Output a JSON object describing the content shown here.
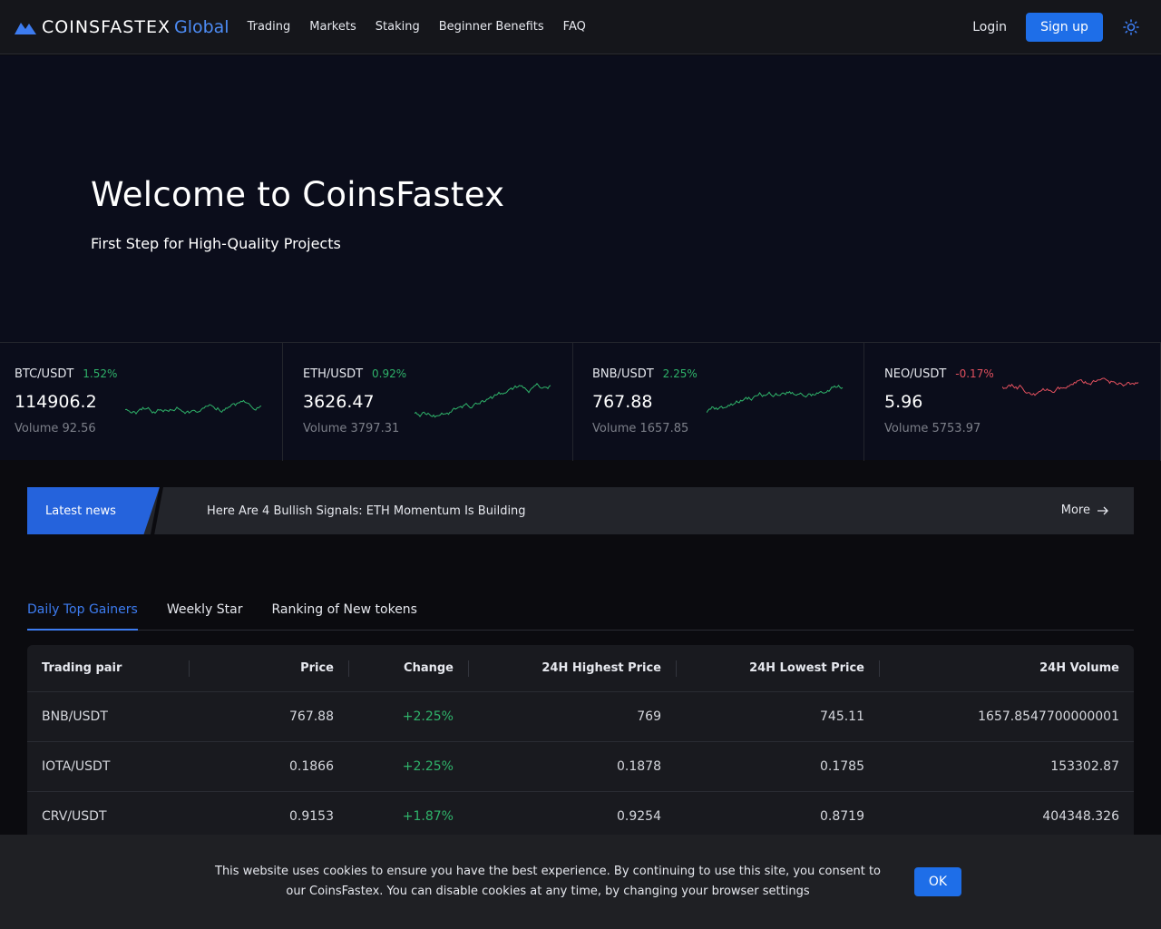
{
  "header": {
    "logo_text": "COINSFASTEX",
    "logo_sub": "Global",
    "nav": [
      "Trading",
      "Markets",
      "Staking",
      "Beginner Benefits",
      "FAQ"
    ],
    "login": "Login",
    "signup": "Sign up",
    "theme_icon": "sun-icon"
  },
  "hero": {
    "title": "Welcome to CoinsFastex",
    "subtitle": "First Step for High-Quality Projects"
  },
  "tickers": [
    {
      "pair": "BTC/USDT",
      "change": "1.52%",
      "price": "114906.2",
      "volume": "Volume 92.56",
      "direction": "up"
    },
    {
      "pair": "ETH/USDT",
      "change": "0.92%",
      "price": "3626.47",
      "volume": "Volume 3797.31",
      "direction": "up"
    },
    {
      "pair": "BNB/USDT",
      "change": "2.25%",
      "price": "767.88",
      "volume": "Volume 1657.85",
      "direction": "up"
    },
    {
      "pair": "NEO/USDT",
      "change": "-0.17%",
      "price": "5.96",
      "volume": "Volume 5753.97",
      "direction": "down"
    }
  ],
  "colors": {
    "up": "#2fb36a",
    "down": "#e2505e",
    "accent": "#1e6ee8"
  },
  "news": {
    "tag": "Latest news",
    "headline": "Here Are 4 Bullish Signals: ETH Momentum Is Building",
    "more": "More"
  },
  "tabs": [
    "Daily Top Gainers",
    "Weekly Star",
    "Ranking of New tokens"
  ],
  "active_tab": 0,
  "table": {
    "headers": [
      "Trading pair",
      "Price",
      "Change",
      "24H Highest Price",
      "24H Lowest Price",
      "24H Volume"
    ],
    "rows": [
      [
        "BNB/USDT",
        "767.88",
        "+2.25%",
        "769",
        "745.11",
        "1657.8547700000001"
      ],
      [
        "IOTA/USDT",
        "0.1866",
        "+2.25%",
        "0.1878",
        "0.1785",
        "153302.87"
      ],
      [
        "CRV/USDT",
        "0.9153",
        "+1.87%",
        "0.9254",
        "0.8719",
        "404348.326"
      ]
    ]
  },
  "cookie": {
    "text": "This website uses cookies to ensure you have the best experience. By continuing to use this site, you consent to our CoinsFastex. You can disable cookies at any time, by changing your browser settings",
    "ok": "OK"
  }
}
